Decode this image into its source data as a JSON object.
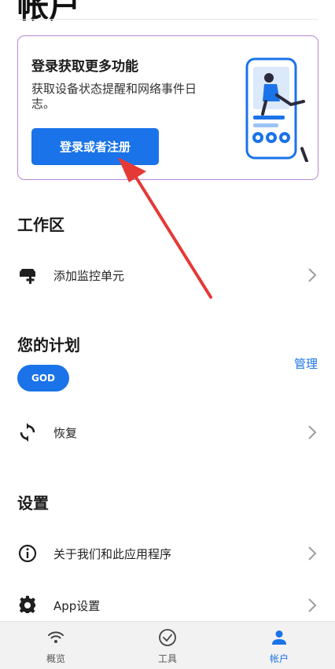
{
  "page": {
    "title": "帐户"
  },
  "promo": {
    "heading": "登录获取更多功能",
    "description": "获取设备状态提醒和网络事件日志。",
    "button_label": "登录或者注册"
  },
  "workspace": {
    "title": "工作区",
    "add_unit_label": "添加监控单元"
  },
  "plan": {
    "title": "您的计划",
    "badge": "GOD",
    "manage_label": "管理",
    "restore_label": "恢复"
  },
  "settings": {
    "title": "设置",
    "about_label": "关于我们和此应用程序",
    "app_settings_label": "App设置"
  },
  "bottom_nav": {
    "items": [
      {
        "label": "概览",
        "icon": "wifi-icon"
      },
      {
        "label": "工具",
        "icon": "check-circle-icon"
      },
      {
        "label": "帐户",
        "icon": "person-icon"
      }
    ],
    "active_index": 2
  },
  "colors": {
    "accent": "#1a73e8",
    "card_border": "#b58ad6",
    "annotation_arrow": "#e53935"
  }
}
